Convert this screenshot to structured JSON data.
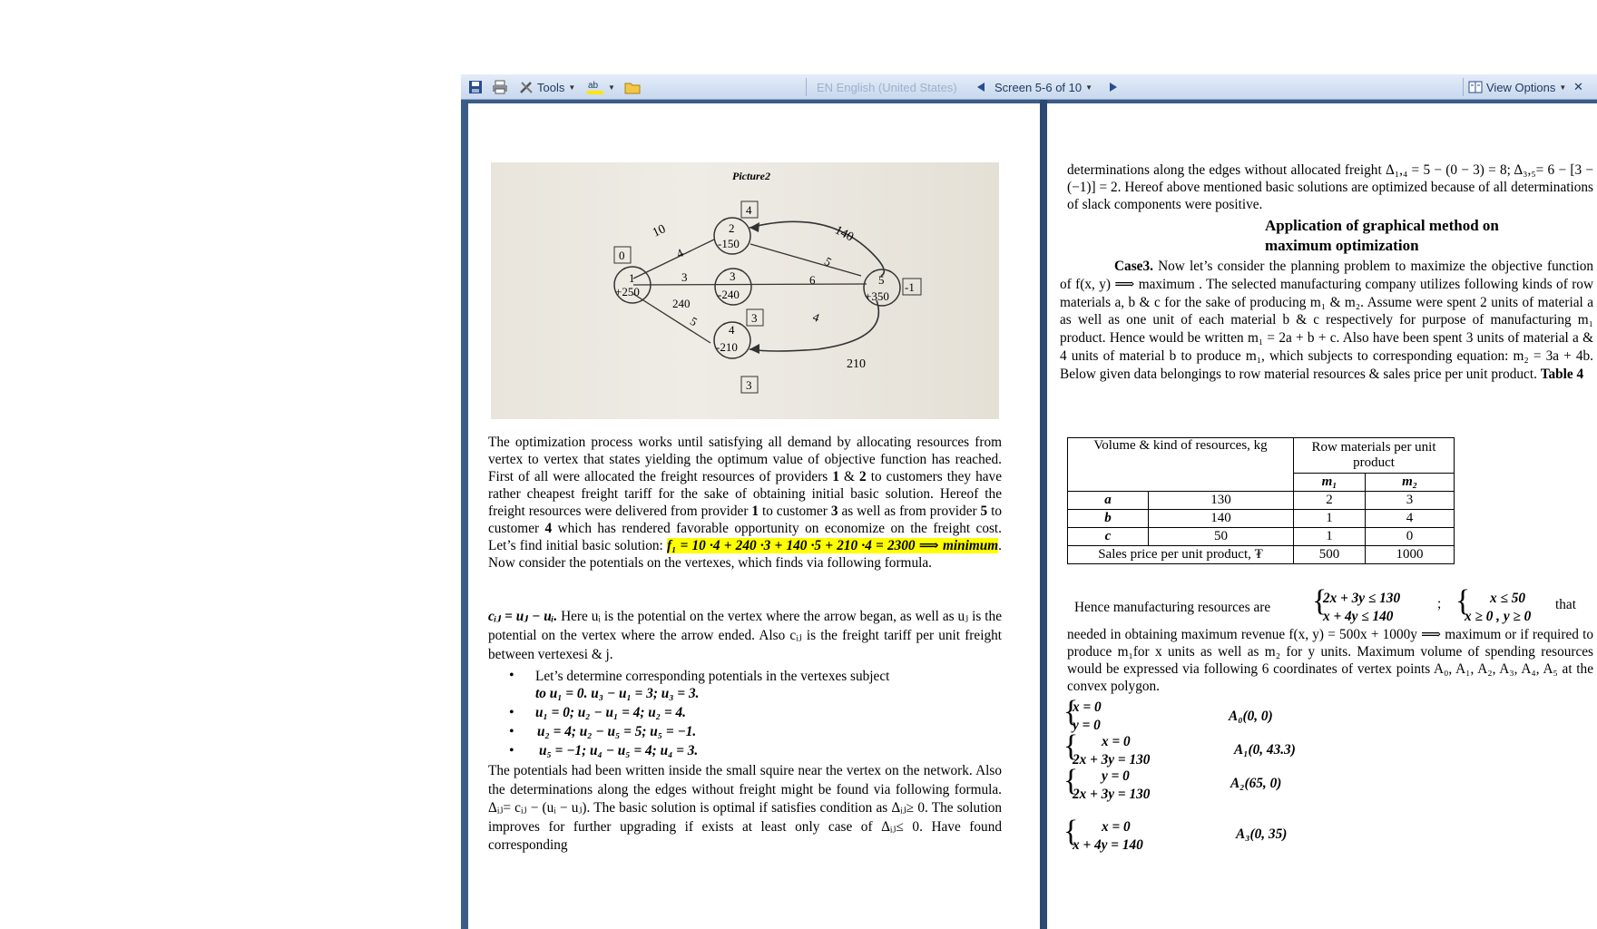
{
  "toolbar": {
    "tools_label": "Tools",
    "language_label": "EN English (United States)",
    "screen_label": "Screen 5-6 of 10",
    "view_options_label": "View Options",
    "close_symbol": "✕",
    "icons": [
      "save-icon",
      "print-icon",
      "tools-icon",
      "highlight-icon",
      "folder-icon",
      "prev-screen-icon",
      "next-screen-icon",
      "view-options-icon",
      "close-icon"
    ]
  },
  "figure": {
    "caption": "Picture2",
    "nodes": [
      {
        "num": "1",
        "pot": "+250"
      },
      {
        "num": "2",
        "pot": "-150"
      },
      {
        "num": "3",
        "pot": "-240"
      },
      {
        "num": "4",
        "pot": "-210"
      },
      {
        "num": "5",
        "pot": "+350"
      }
    ],
    "boxes": [
      "0",
      "4",
      "3",
      "3",
      "-1"
    ],
    "edge_labels": [
      "10",
      "4",
      "140",
      "5",
      "3",
      "240",
      "6",
      "5",
      "4",
      "210"
    ]
  },
  "left_page": {
    "p1": "The optimization process works until satisfying all demand by allocating resources from vertex to vertex that states yielding the optimum value of objective function has reached. First of all were allocated the freight resources of providers",
    "p1_b1": "1",
    "p1_and": " & ",
    "p1_b2": "2",
    "p1_b": " to customers they have rather cheapest freight tariff for the sake of obtaining initial basic solution. Hereof the freight resources were delivered from provider",
    "p1_b3": "1",
    "p1_c": " to customer",
    "p1_b4": "3",
    "p1_d": " as well as from provider",
    "p1_b5": "5",
    "p1_e": " to customer",
    "p1_b6": "4",
    "p1_f": " which has rendered favorable opportunity on economize on the freight cost. Let’s find initial basic solution:",
    "p1_formula": "f₁ = 10 ·4 + 240 ·3 + 140 ·5 + 210 ·4 = 2300 ⟹ minimum",
    "p1_g": ". Now consider the potentials on the vertexes, which finds via following formula.",
    "p2_formula": "cᵢⱼ = uⱼ − uᵢ.",
    "p2_text": " Here uᵢ is the potential on the vertex where the arrow began, as well as uⱼ is the potential on the vertex where the arrow ended. Also cᵢⱼ is the freight tariff per unit freight between vertexesi & j.",
    "bullets": [
      "Let’s determine corresponding potentials in the vertexes subject",
      "to u₁ = 0. u₃ − u₁ = 3;     u₃ = 3.",
      "u₁ = 0;    u₂ − u₁ = 4;          u₂ = 4.",
      "u₂ = 4;   u₂ − u₅ = 5;          u₅ = −1.",
      "u₅ = −1;      u₄ − u₅ = 4;   u₄ = 3."
    ],
    "p3": "The potentials had been written inside the small squire near the vertex on the network. Also the determinations along the edges without freight might be found via following formula. Δᵢⱼ= cᵢⱼ − (uᵢ − uⱼ). The basic solution is optimal if satisfies condition as Δᵢⱼ≥ 0. The solution improves for further upgrading if exists at least only case of Δᵢⱼ≤ 0. Have found corresponding"
  },
  "right_page": {
    "p0": "determinations along the edges without allocated freight Δ₁,₄ = 5 − (0 − 3) = 8;   Δ₃,₅= 6 − [3 − (−1)] = 2. Hereof above mentioned basic solutions are optimized because of all determinations of slack components were positive.",
    "heading_line1": "Application of graphical method on",
    "heading_line2": "maximum optimization",
    "case_label": "Case3.",
    "p1": " Now let’s consider the planning problem to maximize the objective function of f(x, y) ⟹ maximum .  The selected manufacturing company utilizes following kinds of row materials a, b & c for the sake of producing m₁ & m₂. Assume were spent 2 units of material a as well as one unit of each material b & c respectively for purpose of manufacturing m₁ product. Hence would be written m₁ = 2a + b + c. Also have been spent 3 units of material a & 4 units of material b to produce m₁, which subjects to corresponding equation: m₂ = 3a + 4b. Below given data belongings to row material resources & sales price per unit product.",
    "table_label": "Table 4",
    "table": {
      "head_left": "Volume & kind of resources, kg",
      "head_right": "Row materials per unit product",
      "m1": "m₁",
      "m2": "m₂",
      "rows": [
        {
          "name": "a",
          "volume": "130",
          "m1": "2",
          "m2": "3"
        },
        {
          "name": "b",
          "volume": "140",
          "m1": "1",
          "m2": "4"
        },
        {
          "name": "c",
          "volume": "50",
          "m1": "1",
          "m2": "0"
        }
      ],
      "price_label": "Sales price per unit product, ₮",
      "price_m1": "500",
      "price_m2": "1000"
    },
    "resources_lead": "Hence manufacturing resources are",
    "sys1_line1": "2x + 3y ≤ 130",
    "sys1_line2": "x + 4y ≤ 140",
    "sys1_sep": ";",
    "sys2_line1": "x ≤ 50",
    "sys2_line2": "x ≥ 0 ,  y ≥ 0",
    "that": "that",
    "p2": "needed in obtaining maximum revenue  f(x, y) = 500x + 1000y ⟹ maximum or if required to produce m₁for x units as well as m₂ for y units. Maximum volume of spending resources would be expressed via following 6 coordinates of vertex points A₀, A₁, A₂, A₃, A₄, A₅  at the convex polygon.",
    "systems": [
      {
        "l1": "x = 0",
        "l2": "y = 0",
        "pt": "A₀(0,  0)"
      },
      {
        "l1": "x = 0",
        "l2": "2x + 3y = 130",
        "pt": "A₁(0,  43.3)"
      },
      {
        "l1": "y = 0",
        "l2": "2x + 3y = 130",
        "pt": "A₂(65,  0)"
      },
      {
        "l1": "x = 0",
        "l2": "x + 4y = 140",
        "pt": "A₃(0,  35)"
      }
    ]
  }
}
